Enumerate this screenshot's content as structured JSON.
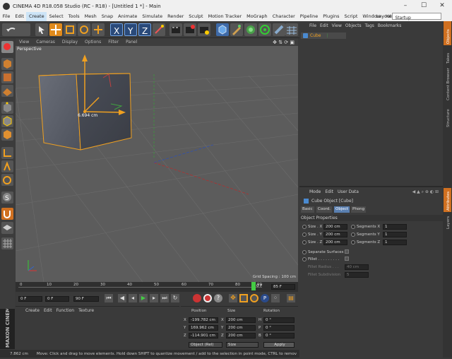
{
  "window": {
    "title": "CINEMA 4D R18.058 Studio (RC - R18) - [Untitled 1 *] - Main",
    "min": "–",
    "max": "☐",
    "close": "✕"
  },
  "menu": [
    "File",
    "Edit",
    "Create",
    "Select",
    "Tools",
    "Mesh",
    "Snap",
    "Animate",
    "Simulate",
    "Render",
    "Sculpt",
    "Motion Tracker",
    "MoGraph",
    "Character",
    "Pipeline",
    "Plugins",
    "Script",
    "Window",
    "Help"
  ],
  "layout": {
    "label": "Layout:",
    "value": "Startup"
  },
  "viewport": {
    "menu": [
      "View",
      "Cameras",
      "Display",
      "Options",
      "Filter",
      "Panel"
    ],
    "name": "Perspective",
    "measure": "6.694 cm",
    "grid_spacing": "Grid Spacing : 100 cm"
  },
  "timeline": {
    "ticks": [
      "0",
      "10",
      "20",
      "30",
      "40",
      "50",
      "60",
      "70",
      "80",
      "90"
    ],
    "frame": "0 F",
    "end": "85 F"
  },
  "transport": {
    "start": "0 F",
    "cur": "0 F",
    "end": "90 F"
  },
  "materials": {
    "menu": [
      "Create",
      "Edit",
      "Function",
      "Texture"
    ]
  },
  "coords": {
    "headers": [
      "Position",
      "Size",
      "Rotation"
    ],
    "rows": [
      {
        "axis": "X",
        "pos": "-199.782 cm",
        "saxis": "X",
        "size": "200 cm",
        "raxis": "H",
        "rot": "0 °"
      },
      {
        "axis": "Y",
        "pos": "169.962 cm",
        "saxis": "Y",
        "size": "200 cm",
        "raxis": "P",
        "rot": "0 °"
      },
      {
        "axis": "Z",
        "pos": "-114.901 cm",
        "saxis": "Z",
        "size": "200 cm",
        "raxis": "B",
        "rot": "0 °"
      }
    ],
    "mode1": "Object (Rel)",
    "mode2": "Size",
    "apply": "Apply"
  },
  "status": {
    "value": "7.862 cm",
    "text": "Move: Click and drag to move elements. Hold down SHIFT to quantize movement / add to the selection in point mode, CTRL to remov"
  },
  "objects": {
    "menu": [
      "File",
      "Edit",
      "View",
      "Objects",
      "Tags",
      "Bookmarks"
    ],
    "item": "Cube"
  },
  "attributes": {
    "menu": [
      "Mode",
      "Edit",
      "User Data"
    ],
    "title": "Cube Object [Cube]",
    "tabs": [
      "Basic",
      "Coord.",
      "Object",
      "Phong"
    ],
    "section": "Object Properties",
    "sizes": [
      {
        "label": "Size . X",
        "value": "200 cm",
        "seg": "Segments X",
        "segv": "1"
      },
      {
        "label": "Size . Y",
        "value": "200 cm",
        "seg": "Segments Y",
        "segv": "1"
      },
      {
        "label": "Size . Z",
        "value": "200 cm",
        "seg": "Segments Z",
        "segv": "1"
      }
    ],
    "sep": "Separate Surfaces",
    "fillet": "Fillet . . . . . . . . .",
    "radius": "Fillet Radius . . .",
    "radius_v": "40 cm",
    "sub": "Fillet Subdivision",
    "sub_v": "5"
  },
  "sidetabs": [
    "Objects",
    "Takes",
    "Content Browser",
    "Structure"
  ],
  "sidetabs2": [
    "Attributes",
    "Layers"
  ],
  "brand": "MAXON CINEMA 4D"
}
